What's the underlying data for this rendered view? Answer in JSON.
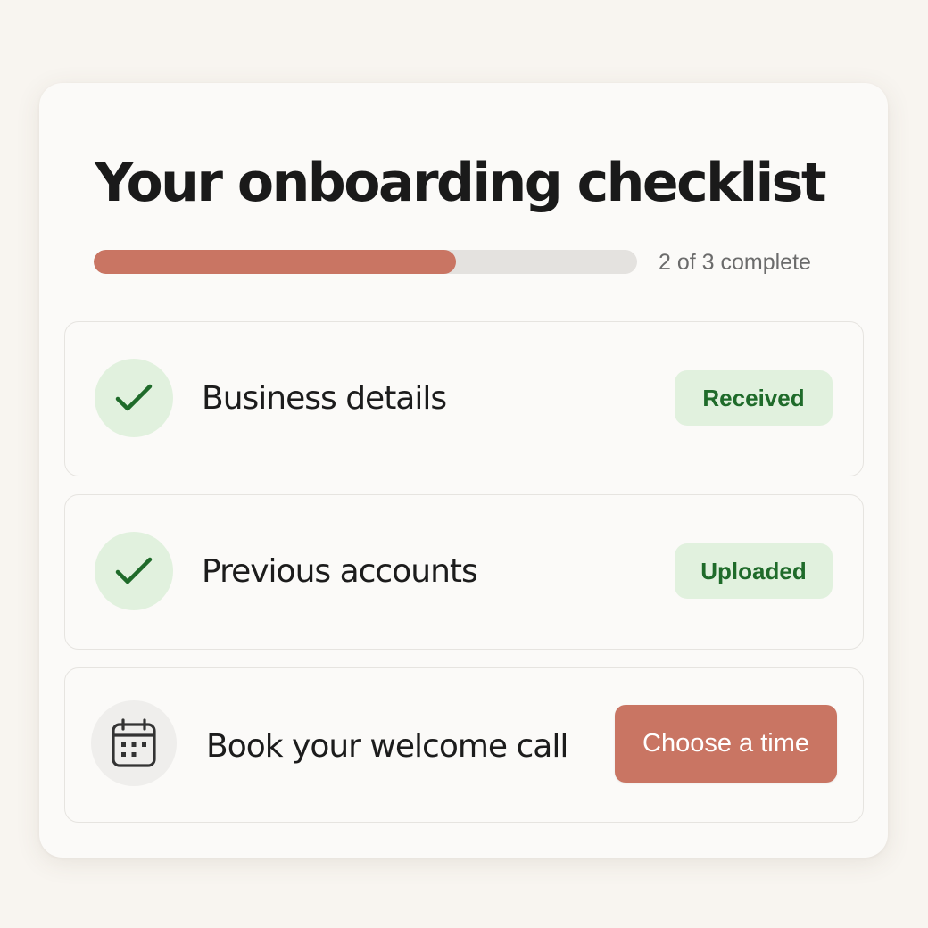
{
  "checklist": {
    "title": "Your onboarding checklist",
    "progress": {
      "completed": 2,
      "total": 3,
      "text": "2 of 3 complete"
    },
    "tasks": [
      {
        "label": "Business details",
        "status": "done",
        "icon": "check-icon",
        "badge": "Received"
      },
      {
        "label": "Previous accounts",
        "status": "done",
        "icon": "check-icon",
        "badge": "Uploaded"
      },
      {
        "label": "Book your welcome call",
        "status": "todo",
        "icon": "calendar-icon",
        "action_label": "Choose a time"
      }
    ]
  },
  "colors": {
    "accent": "#c97563",
    "success_text": "#1f6b2a",
    "success_bg": "#e1f1de",
    "track": "#e4e2df",
    "page_bg": "#f8f5f0"
  }
}
